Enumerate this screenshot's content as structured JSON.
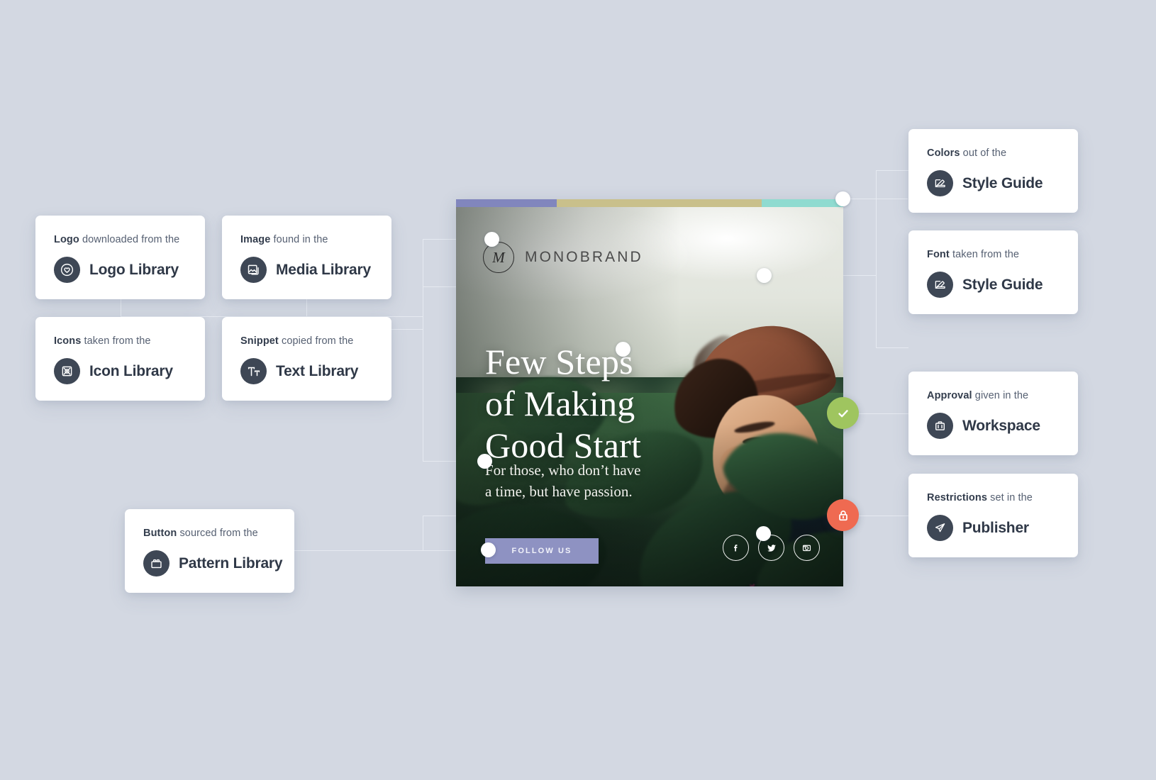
{
  "canvas": {
    "background": "#d3d8e2",
    "connector_color": "#e6eaf1"
  },
  "cards": {
    "logo": {
      "caption_bold": "Logo",
      "caption_rest": " downloaded from the",
      "title": "Logo Library",
      "icon": "heart-shield-icon"
    },
    "image": {
      "caption_bold": "Image",
      "caption_rest": " found in the",
      "title": "Media Library",
      "icon": "photo-stack-icon"
    },
    "icons": {
      "caption_bold": "Icons",
      "caption_rest": " taken from the",
      "title": "Icon Library",
      "icon": "icon-grid-icon"
    },
    "snippet": {
      "caption_bold": "Snippet",
      "caption_rest": " copied from the",
      "title": "Text Library",
      "icon": "text-size-icon"
    },
    "button": {
      "caption_bold": "Button",
      "caption_rest": " sourced from the",
      "title": "Pattern Library",
      "icon": "pattern-brick-icon"
    },
    "colors": {
      "caption_bold": "Colors",
      "caption_rest": " out of the",
      "title": "Style Guide",
      "icon": "color-swatch-icon"
    },
    "font": {
      "caption_bold": "Font",
      "caption_rest": " taken from the",
      "title": "Style Guide",
      "icon": "color-swatch-icon"
    },
    "approval": {
      "caption_bold": "Approval",
      "caption_rest": " given in the",
      "title": "Workspace",
      "icon": "briefcase-icon"
    },
    "restrictions": {
      "caption_bold": "Restrictions",
      "caption_rest": " set in the",
      "title": "Publisher",
      "icon": "paper-plane-icon"
    }
  },
  "poster": {
    "brand_name": "MONOBRAND",
    "logo_monogram": "M",
    "headline_line1": "Few Steps",
    "headline_line2": "of Making",
    "headline_line3": "Good Start",
    "subhead_line1": "For those, who don’t have",
    "subhead_line2": "a time, but have passion.",
    "button_label": "FOLLOW US",
    "button_color": "#8e92c2",
    "colorbar": [
      {
        "name": "periwinkle",
        "hex": "#8186bd",
        "width_pct": 26
      },
      {
        "name": "khaki",
        "hex": "#c9c08b",
        "width_pct": 53
      },
      {
        "name": "mint",
        "hex": "#8fdbd0",
        "width_pct": 21
      }
    ],
    "socials": [
      "facebook-icon",
      "twitter-icon",
      "instagram-icon"
    ]
  },
  "status_badges": {
    "approved": {
      "icon": "check-icon",
      "color": "#9fc55f"
    },
    "locked": {
      "icon": "lock-icon",
      "color": "#ef6a51"
    }
  }
}
